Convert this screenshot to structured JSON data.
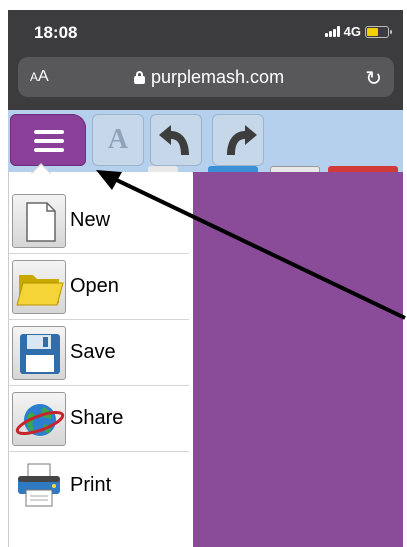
{
  "status_bar": {
    "time": "18:08",
    "network": "4G",
    "signal_bars": 3,
    "battery_level": 0.5,
    "battery_color": "#f5d000"
  },
  "address_bar": {
    "text_size_control": "AA",
    "url": "purplemash.com",
    "reload_icon": "reload-icon",
    "lock_icon": "lock-icon"
  },
  "toolbar": {
    "menu_icon": "hamburger-menu-icon",
    "font_button_label": "A",
    "undo_icon": "undo-icon",
    "redo_icon": "redo-icon",
    "background_color": "#b4d0ec",
    "menu_button_color": "#8a3f98"
  },
  "file_menu": {
    "items": [
      {
        "label": "New",
        "icon": "new-document-icon"
      },
      {
        "label": "Open",
        "icon": "folder-icon"
      },
      {
        "label": "Save",
        "icon": "floppy-disk-icon"
      },
      {
        "label": "Share",
        "icon": "globe-icon"
      },
      {
        "label": "Print",
        "icon": "printer-icon"
      }
    ]
  },
  "canvas": {
    "background_color": "#8a4b98"
  }
}
